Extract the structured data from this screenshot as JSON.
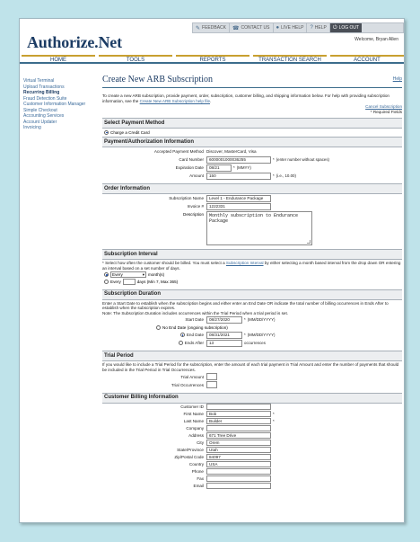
{
  "topbar": {
    "feedback": "FEEDBACK",
    "contact": "CONTACT US",
    "live_help": "LIVE HELP",
    "help": "HELP",
    "logout": "LOG OUT"
  },
  "header": {
    "logo": "Authorize.Net",
    "welcome": "Welcome, Bryan Allen"
  },
  "nav": [
    "HOME",
    "TOOLS",
    "REPORTS",
    "TRANSACTION SEARCH",
    "ACCOUNT"
  ],
  "sidebar": [
    "Virtual Terminal",
    "Upload Transactions",
    "Recurring Billing",
    "Fraud Detection Suite",
    "Customer Information Manager",
    "Simple Checkout",
    "Accounting Services",
    "Account Updater",
    "Invoicing"
  ],
  "page": {
    "title": "Create New ARB Subscription",
    "help": "Help",
    "intro": "To create a new ARB subscription, provide payment, order, subscription, customer billing, and shipping information below. For help with providing subscription information, see the",
    "intro_link": "Create New ARB Subscription help file",
    "cancel": "Cancel Subscription",
    "required": "* Required Fields"
  },
  "payment_method": {
    "header": "Select Payment Method",
    "option": "Charge a Credit Card"
  },
  "payment_info": {
    "header": "Payment/Authorization Information",
    "accepted_label": "Accepted Payment Method",
    "accepted_value": "Discover, MasterCard, Visa",
    "card_label": "Card Number",
    "card_value": "6000001000036255",
    "card_note": "(enter number without spaces)",
    "exp_label": "Expiration Date",
    "exp_value": "08/21",
    "exp_note": "(MMYY)",
    "amount_label": "Amount",
    "amount_value": "150",
    "amount_note": "(i.e., 10.00)"
  },
  "order": {
    "header": "Order Information",
    "name_label": "Subscription Name",
    "name_value": "Level 1 - Endurance Package",
    "invoice_label": "Invoice #",
    "invoice_value": "1222331",
    "desc_label": "Description",
    "desc_value": "Monthly subscription to Endurance Package"
  },
  "interval": {
    "header": "Subscription Interval",
    "text_a": "* Select how often the customer should be billed. You must select a",
    "text_link": "Subscription Interval",
    "text_b": "by either selecting a month based interval from the drop down OR entering an interval based on a set number of days.",
    "every_label": "Every",
    "every_select": "Every",
    "month_label": "month(s)",
    "days_label": "Every",
    "days_note": "days (Min 7, Max 365)"
  },
  "duration": {
    "header": "Subscription Duration",
    "text": "Enter a Start Date to establish when the subscription begins and either enter an End Date OR indicate the total number of billing occurrences in Ends After to establish when the subscription expires.",
    "note": "Note: The Subscription Duration includes occurrences within the Trial Period when a trial period is set.",
    "start_label": "Start Date",
    "start_value": "08/27/2020",
    "start_note": "(MM/DD/YYYY)",
    "no_end": "No End Date (ongoing subscription)",
    "end_label": "End Date",
    "end_value": "08/31/2021",
    "end_note": "(MM/DD/YYYY)",
    "after_label": "Ends After",
    "after_value": "13",
    "after_note": "occurrences"
  },
  "trial": {
    "header": "Trial Period",
    "text": "If you would like to include a Trial Period for the subscription, enter the amount of each trial payment in Trial Amount and enter the number of payments that should be included in the Trial Period in Trial Occurrences.",
    "amount_label": "Trial Amount",
    "occ_label": "Trial Occurrences"
  },
  "billing": {
    "header": "Customer Billing Information",
    "fields": [
      {
        "label": "Customer ID",
        "value": ""
      },
      {
        "label": "First Name",
        "value": "Bob"
      },
      {
        "label": "Last Name",
        "value": "Builder"
      },
      {
        "label": "Company",
        "value": ""
      },
      {
        "label": "Address",
        "value": "671 Tree Drive"
      },
      {
        "label": "City",
        "value": "Orem"
      },
      {
        "label": "State/Province",
        "value": "Utah"
      },
      {
        "label": "Zip/Postal Code",
        "value": "84097"
      },
      {
        "label": "Country",
        "value": "USA"
      },
      {
        "label": "Phone",
        "value": ""
      },
      {
        "label": "Fax",
        "value": ""
      },
      {
        "label": "Email",
        "value": ""
      }
    ]
  }
}
